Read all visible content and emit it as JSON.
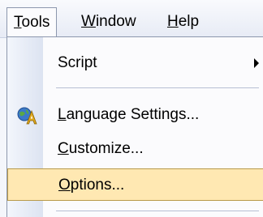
{
  "menubar": {
    "tools": {
      "prefix": "",
      "mnemonic": "T",
      "rest": "ools"
    },
    "window": {
      "prefix": "",
      "mnemonic": "W",
      "rest": "indow"
    },
    "help": {
      "prefix": "",
      "mnemonic": "H",
      "rest": "elp"
    }
  },
  "tools_menu": {
    "script": {
      "prefix": "Script",
      "mnemonic": "",
      "rest": ""
    },
    "language_settings": {
      "prefix": "",
      "mnemonic": "L",
      "rest": "anguage Settings..."
    },
    "customize": {
      "prefix": "",
      "mnemonic": "C",
      "rest": "ustomize..."
    },
    "options": {
      "prefix": "",
      "mnemonic": "O",
      "rest": "ptions..."
    }
  },
  "icons": {
    "language_settings": "language-settings-icon",
    "script_submenu": "submenu-arrow-icon"
  },
  "colors": {
    "highlight": "#ffe8b2",
    "highlight_border": "#b89a4a",
    "gutter": "#dce3f1"
  }
}
